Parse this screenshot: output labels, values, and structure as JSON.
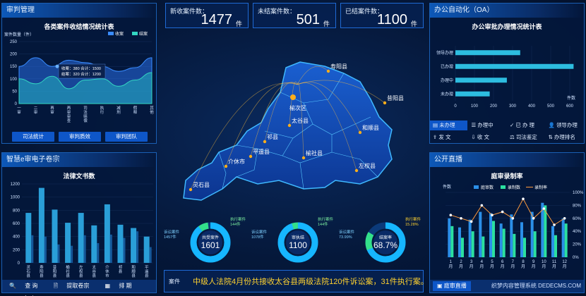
{
  "stats": {
    "new": {
      "label": "新收案件数：",
      "value": "1477",
      "unit": "件"
    },
    "open": {
      "label": "未结案件数：",
      "value": "501",
      "unit": "件"
    },
    "closed": {
      "label": "已结案件数：",
      "value": "1100",
      "unit": "件"
    }
  },
  "trial": {
    "panel_title": "审判管理",
    "chart_title": "各类案件收结情况统计表",
    "buttons": [
      "司法统计",
      "审判质效",
      "审判团队"
    ]
  },
  "docs": {
    "panel_title": "智慧e审电子卷宗",
    "chart_title": "法律文书数"
  },
  "oa": {
    "panel_title": "办公自动化（OA）",
    "chart_title": "办公审批办理情况统计表",
    "tabs": [
      "未办理",
      "办理中",
      "已 办 理",
      "领导办理",
      "发  文",
      "收  文",
      "司法鉴定",
      "办理排名"
    ]
  },
  "live": {
    "panel_title": "公开直播",
    "chart_title": "庭审录制率",
    "button": "庭审直播"
  },
  "left_footer": [
    "查  询",
    "提取卷宗",
    "排  期",
    "审  案"
  ],
  "map": {
    "regions": [
      "寿阳县",
      "榆次区",
      "昔阳县",
      "和顺县",
      "太谷县",
      "祁县",
      "平遥县",
      "介休市",
      "榆社县",
      "左权县",
      "灵石县"
    ]
  },
  "donuts": [
    {
      "center_label": "共受案件",
      "center_value": "1601",
      "left_label": "诉讼案件",
      "left_value": "1457件",
      "right_label": "执行案件",
      "right_value": "144件"
    },
    {
      "center_label": "审执结",
      "center_value": "1100",
      "left_label": "诉讼案件",
      "left_value": "1078件",
      "right_label": "执行案件",
      "right_value": "144件"
    },
    {
      "center_label": "结案率",
      "center_value": "68.7%",
      "left_label": "诉讼案件",
      "left_value": "73.99%",
      "right_label": "执行案件",
      "right_value": "15.28%"
    }
  ],
  "ticker": {
    "tag": "案件",
    "text": "中级人法院4月份共接收太谷县两级法院120件诉讼案，31件执行案。"
  },
  "watermark": "织梦内容管理系统 DEDECMS.COM",
  "chart_data": [
    {
      "type": "area",
      "title": "各类案件收结情况统计表",
      "ylabel": "案件数量（件）",
      "ylim": [
        0,
        250
      ],
      "categories": [
        "一审",
        "二审",
        "再审",
        "再审审查",
        "司法赔偿",
        "执行",
        "减刑",
        "假释",
        "其他"
      ],
      "series": [
        {
          "name": "收案",
          "values": [
            150,
            185,
            150,
            175,
            165,
            150,
            130,
            145,
            185
          ]
        },
        {
          "name": "结案",
          "values": [
            100,
            80,
            110,
            60,
            95,
            100,
            70,
            95,
            125
          ]
        }
      ],
      "tooltip": [
        "收案：380  合计：1500",
        "结案：320  合计：1200"
      ]
    },
    {
      "type": "bar",
      "title": "法律文书数",
      "ylim": [
        0,
        1200
      ],
      "categories": [
        "灵石县",
        "寿阳县",
        "昔阳县",
        "榆社县",
        "左权县",
        "太谷县",
        "介休市",
        "祁县",
        "和顺县",
        "平遥县"
      ],
      "values": [
        760,
        1140,
        810,
        610,
        760,
        570,
        890,
        580,
        530,
        400
      ],
      "secondary_values": [
        420,
        400,
        280,
        260,
        420,
        300,
        430,
        380,
        480,
        240
      ]
    },
    {
      "type": "bar",
      "orientation": "horizontal",
      "title": "办公审批办理情况统计表",
      "xlabel": "件数",
      "xlim": [
        0,
        600
      ],
      "categories": [
        "领导办理",
        "已办理",
        "办理中",
        "未办理"
      ],
      "values": [
        340,
        620,
        270,
        180
      ]
    },
    {
      "type": "bar",
      "title": "庭审录制率",
      "ylabel": "件数",
      "categories": [
        "1月",
        "2月",
        "3月",
        "4月",
        "5月",
        "6月",
        "7月",
        "8月",
        "9月",
        "10月",
        "11月",
        "12月"
      ],
      "series": [
        {
          "name": "庭审数",
          "values": [
            300,
            230,
            290,
            350,
            340,
            260,
            330,
            270,
            350,
            420,
            240,
            300
          ]
        },
        {
          "name": "录制数",
          "values": [
            240,
            150,
            200,
            160,
            280,
            220,
            180,
            150,
            200,
            400,
            170,
            260
          ]
        },
        {
          "name": "录制率",
          "values": [
            65,
            60,
            55,
            80,
            65,
            70,
            60,
            90,
            60,
            75,
            50,
            60
          ]
        }
      ],
      "right_axis": [
        "0%",
        "20%",
        "40%",
        "60%",
        "80%",
        "100%"
      ]
    }
  ]
}
